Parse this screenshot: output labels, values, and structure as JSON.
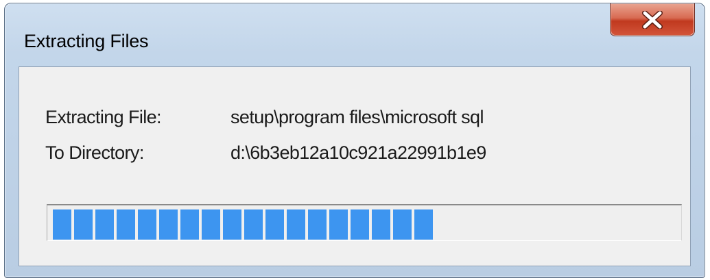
{
  "window": {
    "title": "Extracting Files"
  },
  "details": {
    "file_label": "Extracting File:",
    "file_value": "setup\\program files\\microsoft sql",
    "directory_label": "To Directory:",
    "directory_value": "d:\\6b3eb12a10c921a22991b1e9"
  },
  "progress": {
    "percent": 62,
    "filled_blocks": 18,
    "color": "#3d95f0"
  },
  "icons": {
    "close": "close-icon"
  },
  "colors": {
    "close_button": "#c94a30",
    "title_bar": "#c3d6ea",
    "client_background": "#f0f0f0"
  }
}
